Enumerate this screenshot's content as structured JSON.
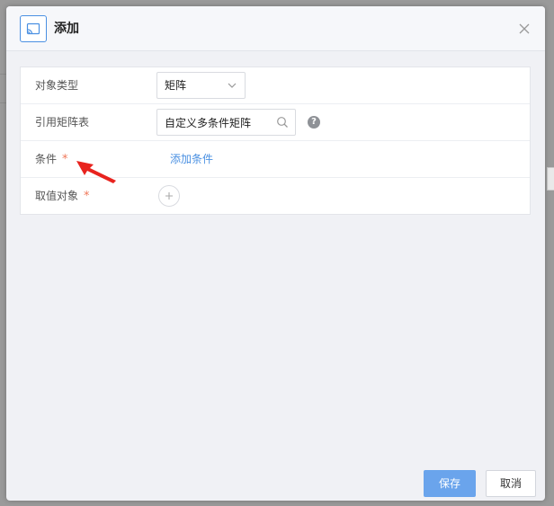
{
  "dialog": {
    "title": "添加",
    "header_icon": "cast-icon",
    "close_icon": "close-icon"
  },
  "form": {
    "object_type": {
      "label": "对象类型",
      "value": "矩阵"
    },
    "matrix_ref": {
      "label": "引用矩阵表",
      "value": "自定义多条件矩阵",
      "help_text": "?"
    },
    "conditions": {
      "label": "条件",
      "required_mark": "*",
      "add_link": "添加条件"
    },
    "value_target": {
      "label": "取值对象",
      "required_mark": "*",
      "add_icon": "plus-icon"
    }
  },
  "footer": {
    "save_label": "保存",
    "cancel_label": "取消"
  },
  "colors": {
    "accent": "#4a90e2",
    "primary_button": "#6aa4ec",
    "required": "#f0785a",
    "annotation_arrow": "#e8231e"
  }
}
